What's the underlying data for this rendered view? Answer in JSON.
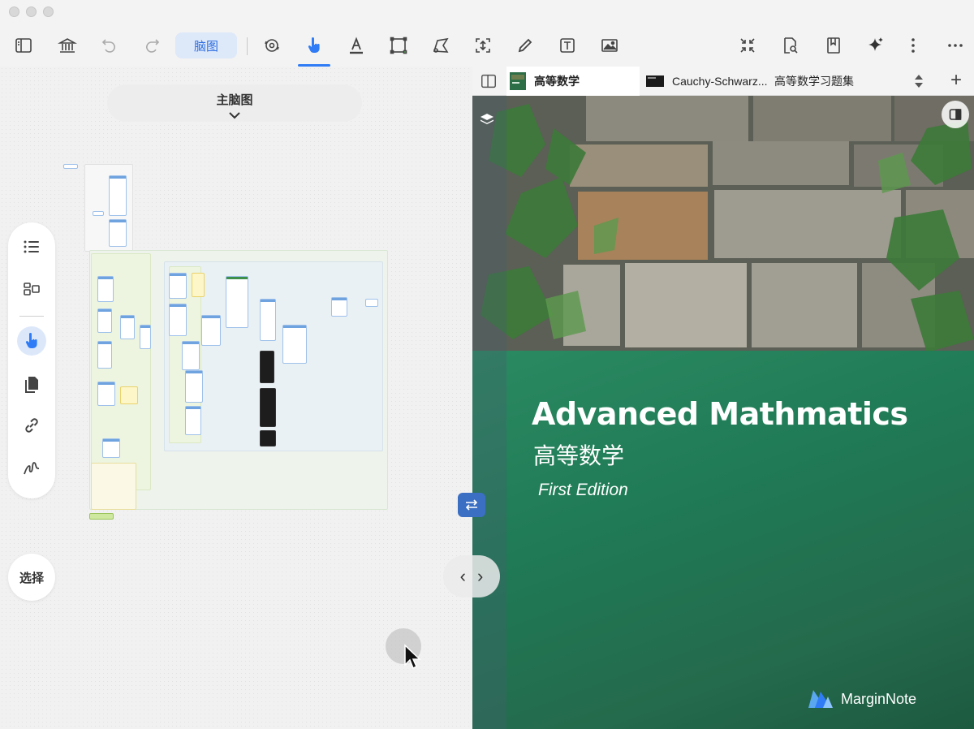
{
  "toolbar": {
    "mindmap_label": "脑图",
    "icons": [
      "sidebar-icon",
      "library-icon",
      "undo-icon",
      "redo-icon",
      "mindmap-toggle",
      "sync-icon",
      "hand-pointer-icon",
      "text-highlight-icon",
      "rect-select-icon",
      "lasso-icon",
      "crop-icon",
      "pen-icon",
      "textbox-icon",
      "image-icon",
      "collapse-icon",
      "search-doc-icon",
      "bookmark-icon",
      "ai-sparkle-icon",
      "more-vertical-icon",
      "more-horizontal-icon"
    ]
  },
  "mindmap": {
    "title": "主脑图",
    "select_label": "选择"
  },
  "tabs": [
    {
      "label": "高等数学",
      "active": true
    },
    {
      "label": "Cauchy-Schwarz...",
      "active": false
    },
    {
      "label": "高等数学习题集",
      "active": false
    }
  ],
  "book": {
    "title_en": "Advanced Mathmatics",
    "title_zh": "高等数学",
    "edition": "First Edition",
    "brand": "MarginNote"
  },
  "colors": {
    "accent": "#2f7cf6",
    "cover_green": "#1f7a55"
  }
}
